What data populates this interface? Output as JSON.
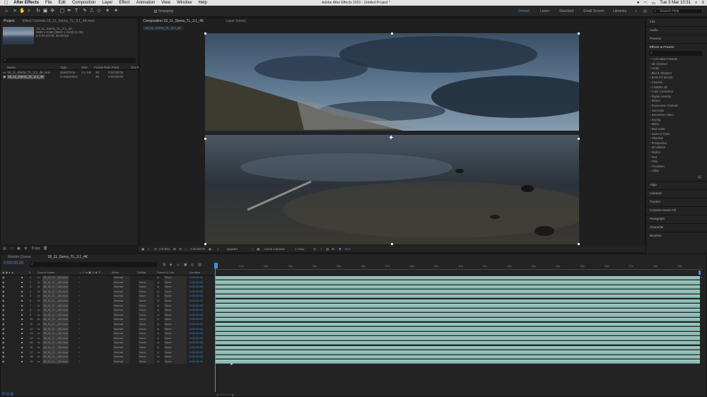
{
  "menubar": {
    "app": "After Effects",
    "items": [
      "File",
      "Edit",
      "Composition",
      "Layer",
      "Effect",
      "Animation",
      "View",
      "Window",
      "Help"
    ],
    "doc_title": "Adobe After Effects 2020 - Untitled Project *",
    "clock": "Tue 3 Mar 10:31"
  },
  "toolbar": {
    "snapping": "Snapping",
    "workspaces": [
      "Default",
      "Learn",
      "Standard",
      "Small Screen",
      "Libraries"
    ],
    "search_placeholder": "Search Help",
    "active_workspace": "Default",
    "accent_color": "#3f8fe0"
  },
  "project": {
    "tab": "Project",
    "effect_controls_tab": "Effect Controls 18_11_Sierra_TL_3.1_4K.mov",
    "thumb_name": "18_11_Sierra_TL_3.1_4K",
    "thumb_info1": "3840 x 2160 (3840 x 2160) (1.00)",
    "thumb_info2": "Δ 0:00:20:00, 30.00 fps",
    "columns": [
      "Name",
      "Type",
      "Size",
      "Frame Ra...",
      "In Point",
      "Out Po"
    ],
    "items": [
      {
        "name": "18_11_Sierra_TL_3.1_4K.mov",
        "type": "QuickTime",
        "size": "3.1 GB",
        "fps": "30",
        "in": "0:00:00:00"
      },
      {
        "name": "18_11_Sierra_TL_3.1_4K",
        "type": "Composition",
        "size": "",
        "fps": "30",
        "in": "0:00:00:00"
      }
    ],
    "bpc": "8 bpc"
  },
  "composition": {
    "tab": "Composition 18_11_Sierra_TL_3.1_4K",
    "layer_tab": "Layer (none)",
    "breadcrumb": "18_11_Sierra_TL_3.1_4K",
    "zoom": "(70.5%)",
    "timecode": "0:00:00:00",
    "resolution": "Quarter",
    "camera": "Active Camera",
    "views": "1 View",
    "exposure": "+0.0"
  },
  "right_panel": {
    "top": [
      "Info",
      "Audio",
      "Preview"
    ],
    "effects_title": "Effects & Presets",
    "effects": [
      "* Animation Presets",
      "3D Channel",
      "Audio",
      "Blur & Sharpen",
      "Boris FX Mocha",
      "Channel",
      "CINEMA 4D",
      "Color Correction",
      "Digital Anarchy",
      "Distort",
      "Expression Controls",
      "Generate",
      "Immersive Video",
      "Keying",
      "Matte",
      "Red Giant",
      "Noise & Grain",
      "Obsolete",
      "Perspective",
      "Simulation",
      "Stylize",
      "Text",
      "Time",
      "Transition",
      "Utility"
    ],
    "bottom": [
      "Align",
      "Libraries",
      "Tracker",
      "Content-Aware Fill",
      "Paragraph",
      "Character",
      "Brushes"
    ]
  },
  "timeline": {
    "render_queue_tab": "Render Queue",
    "comp_tab": "18_11_Sierra_TL_3.1_4K",
    "timecode": "0:00:00:00",
    "headers": {
      "source": "Source Name",
      "mode": "Mode",
      "trkmat": "TrkMat",
      "parent": "Parent & Link",
      "duration": "Duration"
    },
    "ruler": [
      "0s",
      "01s",
      "02s",
      "03s",
      "04s",
      "05s",
      "06s",
      "07s",
      "08s",
      "09s",
      "10s",
      "11s",
      "12s",
      "13s",
      "14s",
      "15s",
      "16s",
      "17s",
      "18s",
      "19s"
    ],
    "layers": [
      {
        "num": "1",
        "name": "18_11_S..._4K.mov",
        "mode": "Normal",
        "trk": "",
        "parent": "None",
        "dur": "0:00:20:00"
      },
      {
        "num": "2",
        "name": "18_11_S..._4K.mov",
        "mode": "Normal",
        "trk": "None",
        "parent": "None",
        "dur": "0:00:20:00"
      },
      {
        "num": "3",
        "name": "18_11_S..._4K.mov",
        "mode": "Normal",
        "trk": "None",
        "parent": "None",
        "dur": "0:00:20:00"
      },
      {
        "num": "4",
        "name": "18_11_S..._4K.mov",
        "mode": "Normal",
        "trk": "None",
        "parent": "None",
        "dur": "0:00:20:00"
      },
      {
        "num": "5",
        "name": "18_11_S..._4K.mov",
        "mode": "Normal",
        "trk": "None",
        "parent": "None",
        "dur": "0:00:20:00"
      },
      {
        "num": "6",
        "name": "18_11_S..._4K.mov",
        "mode": "Normal",
        "trk": "None",
        "parent": "None",
        "dur": "0:00:20:00"
      },
      {
        "num": "7",
        "name": "18_11_S..._4K.mov",
        "mode": "Normal",
        "trk": "None",
        "parent": "None",
        "dur": "0:00:20:00"
      },
      {
        "num": "8",
        "name": "18_11_S..._4K.mov",
        "mode": "Normal",
        "trk": "None",
        "parent": "None",
        "dur": "0:00:20:00"
      },
      {
        "num": "9",
        "name": "18_11_S..._4K.mov",
        "mode": "Normal",
        "trk": "None",
        "parent": "None",
        "dur": "0:00:20:00"
      },
      {
        "num": "10",
        "name": "18_11_S..._4K.mov",
        "mode": "Normal",
        "trk": "None",
        "parent": "None",
        "dur": "0:00:20:00"
      },
      {
        "num": "11",
        "name": "18_11_S..._4K.mov",
        "mode": "Normal",
        "trk": "None",
        "parent": "None",
        "dur": "0:00:20:00"
      },
      {
        "num": "12",
        "name": "18_11_S..._4K.mov",
        "mode": "Normal",
        "trk": "None",
        "parent": "None",
        "dur": "0:00:20:00"
      },
      {
        "num": "13",
        "name": "18_11_S..._4K.mov",
        "mode": "Normal",
        "trk": "None",
        "parent": "None",
        "dur": "0:00:20:00"
      },
      {
        "num": "14",
        "name": "18_11_S..._4K.mov",
        "mode": "Normal",
        "trk": "None",
        "parent": "None",
        "dur": "0:00:20:00"
      },
      {
        "num": "15",
        "name": "18_11_S..._4K.mov",
        "mode": "Normal",
        "trk": "None",
        "parent": "None",
        "dur": "0:00:20:00"
      },
      {
        "num": "16",
        "name": "18_11_S..._4K.mov",
        "mode": "Normal",
        "trk": "None",
        "parent": "None",
        "dur": "0:00:20:00"
      },
      {
        "num": "17",
        "name": "18_11_S..._4K.mov",
        "mode": "Normal",
        "trk": "None",
        "parent": "None",
        "dur": "0:00:20:00"
      },
      {
        "num": "18",
        "name": "18_11_S..._4K.mov",
        "mode": "Normal",
        "trk": "None",
        "parent": "None",
        "dur": "0:00:20:00"
      },
      {
        "num": "19",
        "name": "18_11_S..._4K.mov",
        "mode": "Normal",
        "trk": "None",
        "parent": "None",
        "dur": "0:00:20:00"
      }
    ],
    "bar_color": "#8fbdb6"
  }
}
